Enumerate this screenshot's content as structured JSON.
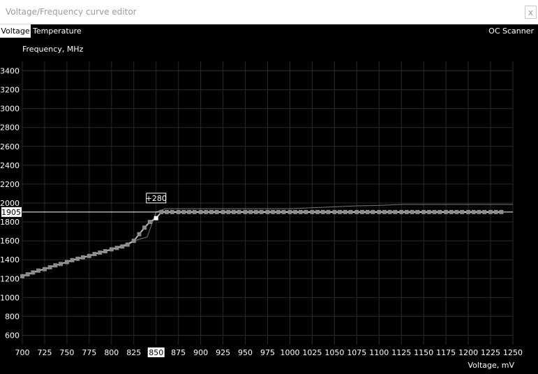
{
  "window": {
    "title": "Voltage/Frequency curve editor",
    "close_glyph": "x"
  },
  "tabs": [
    {
      "label": "Voltage",
      "active": true
    },
    {
      "label": "Temperature",
      "active": false
    }
  ],
  "oc_scanner_label": "OC Scanner",
  "chart_data": {
    "type": "line",
    "ylabel": "Frequency, MHz",
    "xlabel": "Voltage, mV",
    "xlim": [
      700,
      1250
    ],
    "ylim": [
      500,
      3500
    ],
    "grid": true,
    "x_ticks": [
      700,
      725,
      750,
      775,
      800,
      825,
      850,
      875,
      900,
      925,
      950,
      975,
      1000,
      1025,
      1050,
      1075,
      1100,
      1125,
      1150,
      1175,
      1200,
      1225,
      1250
    ],
    "y_ticks": [
      600,
      800,
      1000,
      1200,
      1400,
      1600,
      1800,
      2000,
      2200,
      2400,
      2600,
      2800,
      3000,
      3200,
      3400
    ],
    "selected_x": 850,
    "selected_y_label": "1905",
    "offset_label": "+280",
    "series": [
      {
        "role": "curve",
        "x": [
          700,
          706,
          712,
          718,
          725,
          731,
          737,
          743,
          750,
          756,
          762,
          768,
          775,
          781,
          787,
          793,
          800,
          806,
          812,
          818,
          825,
          831,
          837,
          843,
          850,
          856,
          862,
          868,
          875,
          881,
          887,
          893,
          900,
          906,
          912,
          918,
          925,
          931,
          937,
          943,
          950,
          956,
          962,
          968,
          975,
          981,
          987,
          993,
          1000,
          1006,
          1012,
          1018,
          1025,
          1031,
          1037,
          1043,
          1050,
          1056,
          1062,
          1068,
          1075,
          1081,
          1087,
          1093,
          1100,
          1106,
          1112,
          1118,
          1125,
          1131,
          1137,
          1143,
          1150,
          1156,
          1162,
          1168,
          1175,
          1181,
          1187,
          1193,
          1200,
          1206,
          1212,
          1218,
          1225,
          1231,
          1237
        ],
        "y": [
          1225,
          1245,
          1265,
          1285,
          1300,
          1320,
          1340,
          1355,
          1375,
          1395,
          1410,
          1425,
          1440,
          1460,
          1475,
          1490,
          1510,
          1525,
          1540,
          1560,
          1600,
          1670,
          1740,
          1800,
          1840,
          1905,
          1905,
          1905,
          1905,
          1905,
          1905,
          1905,
          1905,
          1905,
          1905,
          1905,
          1905,
          1905,
          1905,
          1905,
          1905,
          1905,
          1905,
          1905,
          1905,
          1905,
          1905,
          1905,
          1905,
          1905,
          1905,
          1905,
          1905,
          1905,
          1905,
          1905,
          1905,
          1905,
          1905,
          1905,
          1905,
          1905,
          1905,
          1905,
          1905,
          1905,
          1905,
          1905,
          1905,
          1905,
          1905,
          1905,
          1905,
          1905,
          1905,
          1905,
          1905,
          1905,
          1905,
          1905,
          1905,
          1905,
          1905,
          1905,
          1905,
          1905,
          1905
        ]
      },
      {
        "role": "reference",
        "x": [
          700,
          725,
          750,
          775,
          800,
          825,
          840,
          850,
          860,
          1000,
          1050,
          1075,
          1100,
          1125,
          1250
        ],
        "y": [
          1225,
          1300,
          1375,
          1440,
          1510,
          1600,
          1640,
          1905,
          1940,
          1940,
          1960,
          1970,
          1975,
          1985,
          1985
        ]
      }
    ]
  }
}
